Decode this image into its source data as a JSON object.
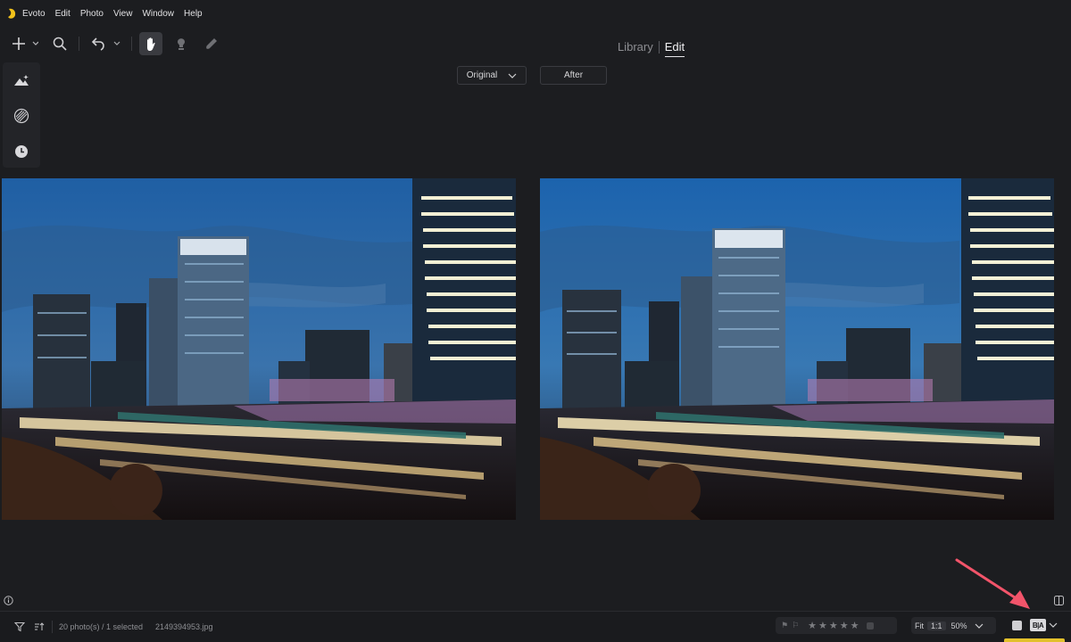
{
  "menu": {
    "app_name": "Evoto",
    "items": [
      "Edit",
      "Photo",
      "View",
      "Window",
      "Help"
    ]
  },
  "mode_switch": {
    "library": "Library",
    "edit": "Edit",
    "active": "Edit"
  },
  "compare": {
    "left_select": "Original",
    "right_label": "After"
  },
  "toolbar": {
    "icons": [
      "add-icon",
      "chevron-down-icon",
      "search-icon",
      "undo-icon",
      "chevron-down-icon",
      "hand-icon",
      "stamp-icon",
      "brush-icon"
    ],
    "active_tool": "hand-icon"
  },
  "left_rail": {
    "icons": [
      "adjust-scene-icon",
      "texture-icon",
      "history-icon"
    ]
  },
  "status": {
    "count": "20 photo(s) / 1 selected",
    "filename": "2149394953.jpg",
    "rating_stars": 5,
    "zoom_fit": "Fit",
    "zoom_1to1": "1:1",
    "zoom_value": "50%",
    "compare_badge": "B|A"
  },
  "colors": {
    "background": "#1c1d20",
    "highlight_arrow": "#f2546a",
    "accent_strip": "#e3c12c"
  }
}
